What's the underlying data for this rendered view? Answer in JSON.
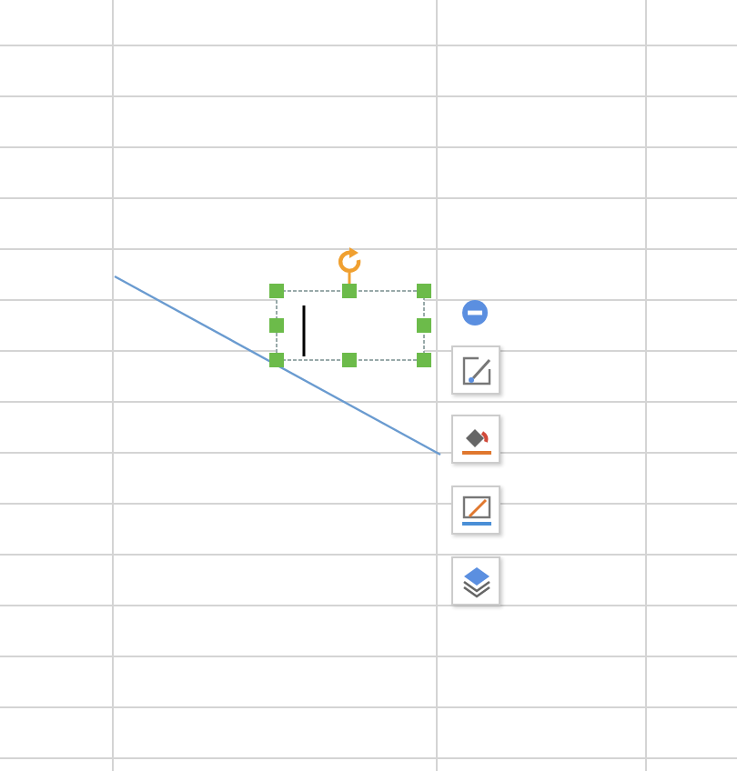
{
  "sheet": {
    "text_box": {
      "selected": true
    },
    "toolbar": [
      {
        "kind": "collapse"
      },
      {
        "kind": "edit"
      },
      {
        "kind": "fill"
      },
      {
        "kind": "outline"
      },
      {
        "kind": "layers"
      }
    ]
  }
}
